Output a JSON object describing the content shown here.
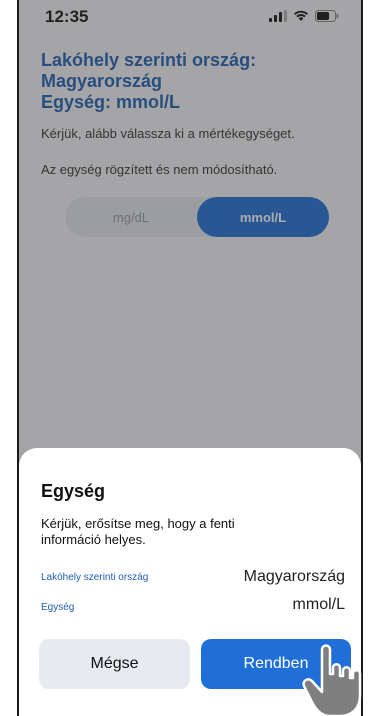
{
  "status_bar": {
    "time": "12:35",
    "icons": [
      "signal-icon",
      "wifi-icon",
      "battery-icon"
    ]
  },
  "header": {
    "country_line1": "Lakóhely szerinti ország:",
    "country_line2": "Magyarország",
    "unit_line": "Egység: mmol/L"
  },
  "instructions": {
    "select_unit": "Kérjük, alább válassza ki a mértékegységet.",
    "fixed_unit": "Az egység rögzített és nem módosítható."
  },
  "unit_selector": {
    "options": [
      "mg/dL",
      "mmol/L"
    ],
    "selected": "mmol/L"
  },
  "dialog": {
    "title": "Egység",
    "message": "Kérjük, erősítse meg, hogy a fenti információ helyes.",
    "rows": [
      {
        "label": "Lakóhely szerinti ország",
        "value": "Magyarország"
      },
      {
        "label": "Egység",
        "value": "mmol/L"
      }
    ],
    "cancel_label": "Mégse",
    "ok_label": "Rendben"
  },
  "colors": {
    "accent": "#1f6fd6",
    "title_blue": "#1e5fb3",
    "cancel_bg": "#e7ebf1"
  }
}
